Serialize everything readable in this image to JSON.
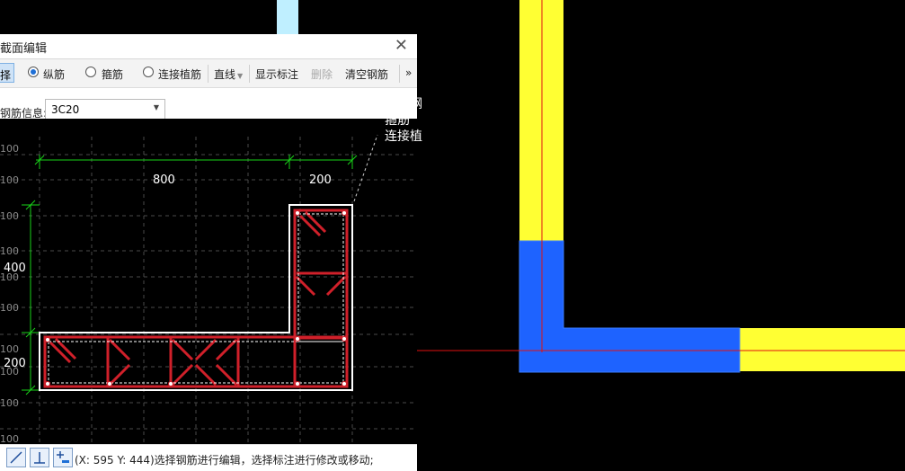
{
  "dialog": {
    "title": "截面编辑",
    "toolbar": {
      "select_label": "择",
      "radio_longitudinal": "纵筋",
      "radio_stirrup": "箍筋",
      "radio_anchor": "连接植筋",
      "line_label": "直线",
      "show_annotation": "显示标注",
      "delete": "删除",
      "clear_rebar": "清空钢筋",
      "more": "»"
    },
    "rebar_info_label": "钢筋信息:",
    "rebar_info_value": "3C20",
    "dims": {
      "top_left": "800",
      "top_right": "200",
      "left_upper": "400",
      "left_lower": "200"
    },
    "grid_label": "100",
    "status_text": "(X: 595 Y: 444)选择钢筋进行编辑，选择标注进行修改或移动;"
  },
  "overlay_note": {
    "line1": "全部钢",
    "line2": "箍筋",
    "line3": "连接植"
  },
  "colors": {
    "yellow": "#ffff33",
    "blue": "#1e63ff",
    "rebar": "#d0202a",
    "dim": "#19d219",
    "crosshair": "#e01010"
  }
}
